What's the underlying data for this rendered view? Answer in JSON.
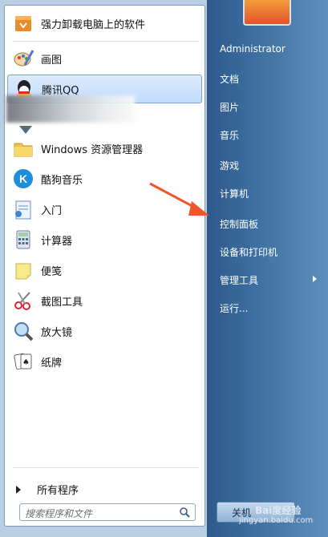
{
  "left_panel": {
    "items": [
      {
        "label": "强力卸载电脑上的软件",
        "icon": "uninstall-box-icon"
      },
      {
        "label": "画图",
        "icon": "paint-palette-icon"
      },
      {
        "label": "腾讯QQ",
        "icon": "qq-penguin-icon",
        "selected": true
      },
      {
        "label": "Windows 资源管理器",
        "icon": "folder-explorer-icon"
      },
      {
        "label": "酷狗音乐",
        "icon": "kugou-k-icon"
      },
      {
        "label": "入门",
        "icon": "getting-started-icon"
      },
      {
        "label": "计算器",
        "icon": "calculator-icon"
      },
      {
        "label": "便笺",
        "icon": "sticky-note-icon"
      },
      {
        "label": "截图工具",
        "icon": "scissors-icon"
      },
      {
        "label": "放大镜",
        "icon": "magnifier-icon"
      },
      {
        "label": "纸牌",
        "icon": "cards-icon"
      }
    ],
    "all_programs_label": "所有程序",
    "search_placeholder": "搜索程序和文件"
  },
  "right_panel": {
    "items": [
      {
        "label": "Administrator"
      },
      {
        "label": "文档"
      },
      {
        "label": "图片"
      },
      {
        "label": "音乐"
      },
      {
        "label": "游戏"
      },
      {
        "label": "计算机"
      },
      {
        "label": "控制面板"
      },
      {
        "label": "设备和打印机"
      },
      {
        "label": "管理工具",
        "has_submenu": true
      },
      {
        "label": "运行..."
      }
    ],
    "shutdown_label": "关机"
  },
  "watermark": {
    "brand": "Bai度经验",
    "url": "jingyan.baidu.com"
  },
  "colors": {
    "highlight_arrow": "#f0562a",
    "panel_blue": "#3d6fa0"
  }
}
